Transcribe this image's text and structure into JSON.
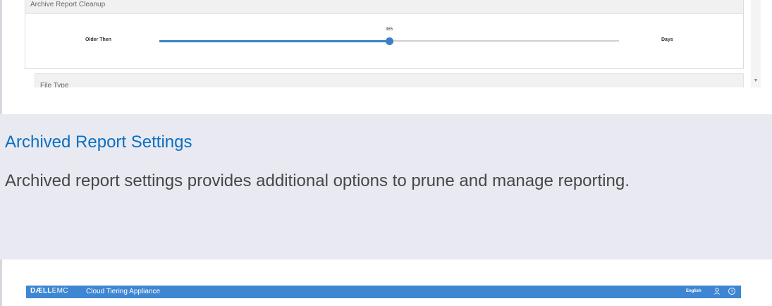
{
  "top_screenshot": {
    "panel_title": "Archive Report Cleanup",
    "slider": {
      "label_left": "Older Then",
      "label_right": "Days",
      "value_text": "365",
      "value_fraction": 0.5
    },
    "next_panel_title": "File Type"
  },
  "document": {
    "heading": "Archived Report Settings",
    "body": "Archived report settings provides additional options to prune and manage reporting."
  },
  "bottom_screenshot": {
    "brand_bold": "DÆLL",
    "brand_light": "EMC",
    "app_title": "Cloud Tiering Appliance",
    "language": "English",
    "user_icon": "user-icon",
    "help_icon": "help-icon"
  },
  "colors": {
    "accent": "#3b80c4",
    "heading": "#0a6fc2",
    "appbar": "#3f86d2"
  }
}
